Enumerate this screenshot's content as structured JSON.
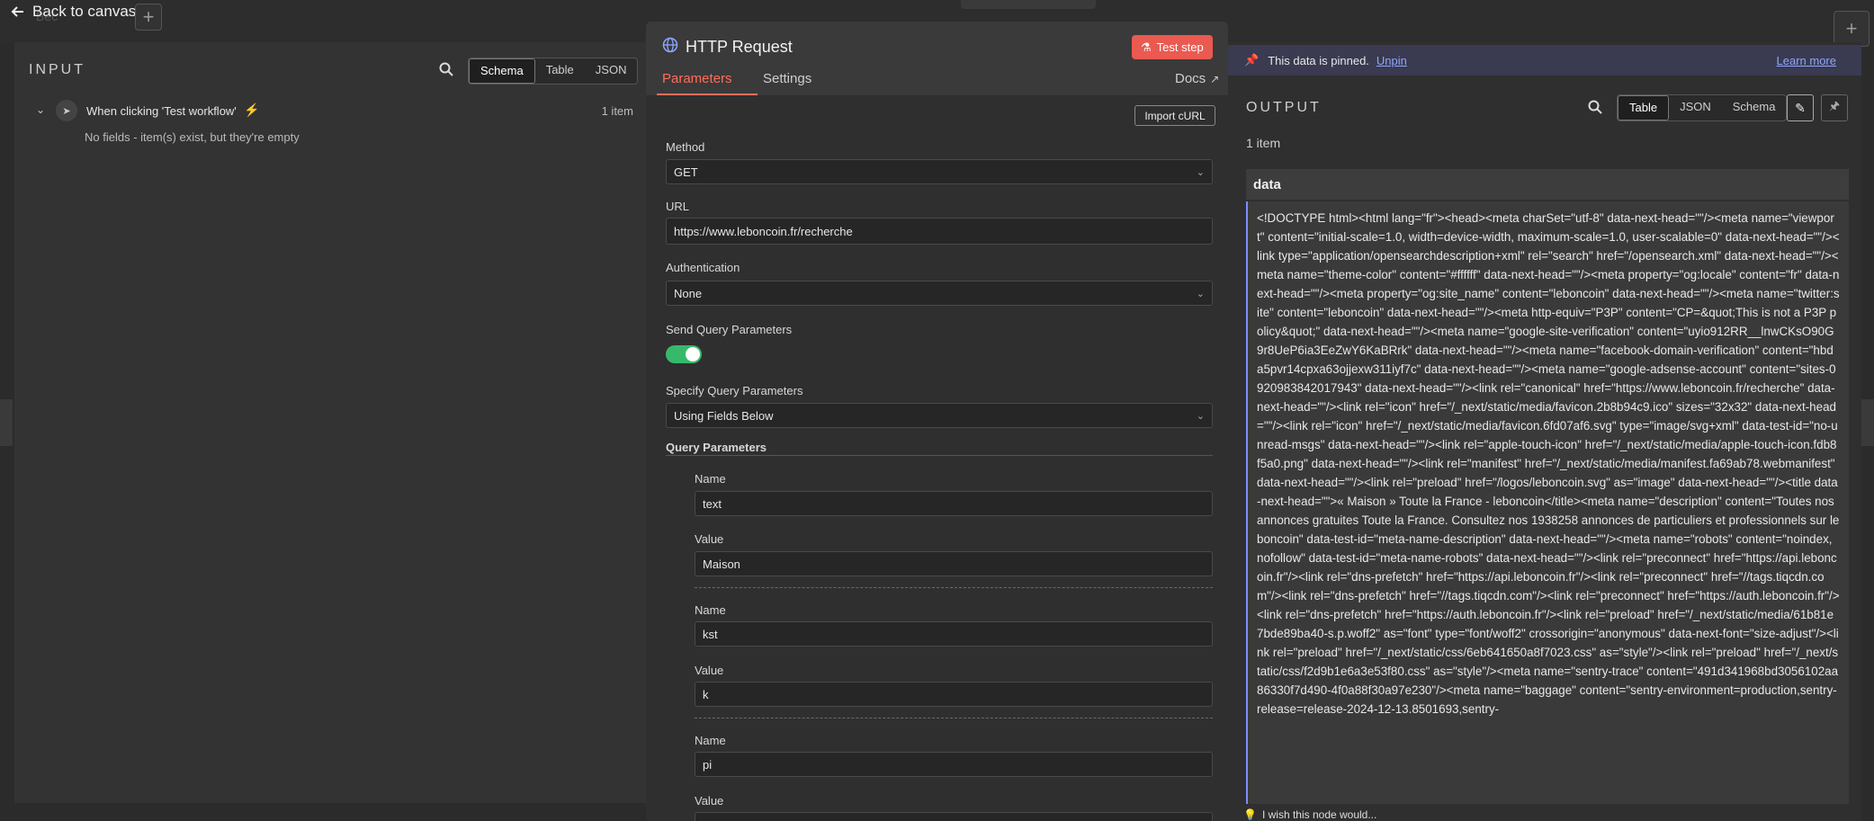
{
  "top": {
    "back_label": "Back to canvas",
    "bg_node_label": "Bec"
  },
  "input": {
    "title": "INPUT",
    "view_tabs": [
      "Schema",
      "Table",
      "JSON"
    ],
    "trigger_label": "When clicking 'Test workflow'",
    "item_count": "1 item",
    "empty_message": "No fields - item(s) exist, but they're empty"
  },
  "node": {
    "title": "HTTP Request",
    "test_button": "Test step",
    "tabs": [
      "Parameters",
      "Settings"
    ],
    "docs_label": "Docs",
    "import_curl": "Import cURL",
    "method": {
      "label": "Method",
      "value": "GET"
    },
    "url": {
      "label": "URL",
      "value": "https://www.leboncoin.fr/recherche"
    },
    "authentication": {
      "label": "Authentication",
      "value": "None"
    },
    "send_query": {
      "label": "Send Query Parameters",
      "enabled": true
    },
    "specify_query": {
      "label": "Specify Query Parameters",
      "value": "Using Fields Below"
    },
    "query_section_label": "Query Parameters",
    "name_label": "Name",
    "value_label": "Value",
    "params": [
      {
        "name": "text",
        "value": "Maison"
      },
      {
        "name": "kst",
        "value": "k"
      },
      {
        "name": "pi",
        "value": ""
      }
    ]
  },
  "output": {
    "pinned_text": "This data is pinned.",
    "unpin": "Unpin",
    "learn_more": "Learn more",
    "title": "OUTPUT",
    "view_tabs": [
      "Table",
      "JSON",
      "Schema"
    ],
    "item_count": "1 item",
    "column_header": "data",
    "data_text": "<!DOCTYPE html><html lang=\"fr\"><head><meta charSet=\"utf-8\" data-next-head=\"\"/><meta name=\"viewport\" content=\"initial-scale=1.0, width=device-width, maximum-scale=1.0, user-scalable=0\" data-next-head=\"\"/><link type=\"application/opensearchdescription+xml\" rel=\"search\" href=\"/opensearch.xml\" data-next-head=\"\"/><meta name=\"theme-color\" content=\"#ffffff\" data-next-head=\"\"/><meta property=\"og:locale\" content=\"fr\" data-next-head=\"\"/><meta property=\"og:site_name\" content=\"leboncoin\" data-next-head=\"\"/><meta name=\"twitter:site\" content=\"leboncoin\" data-next-head=\"\"/><meta http-equiv=\"P3P\" content=\"CP=&quot;This is not a P3P policy&quot;\" data-next-head=\"\"/><meta name=\"google-site-verification\" content=\"uyio912RR__lnwCKsO90G9r8UeP6ia3EeZwY6KaBRrk\" data-next-head=\"\"/><meta name=\"facebook-domain-verification\" content=\"hbda5pvr14cpxa63ojjexw311iyf7c\" data-next-head=\"\"/><meta name=\"google-adsense-account\" content=\"sites-0920983842017943\" data-next-head=\"\"/><link rel=\"canonical\" href=\"https://www.leboncoin.fr/recherche\" data-next-head=\"\"/><link rel=\"icon\" href=\"/_next/static/media/favicon.2b8b94c9.ico\" sizes=\"32x32\" data-next-head=\"\"/><link rel=\"icon\" href=\"/_next/static/media/favicon.6fd07af6.svg\" type=\"image/svg+xml\" data-test-id=\"no-unread-msgs\" data-next-head=\"\"/><link rel=\"apple-touch-icon\" href=\"/_next/static/media/apple-touch-icon.fdb8f5a0.png\" data-next-head=\"\"/><link rel=\"manifest\" href=\"/_next/static/media/manifest.fa69ab78.webmanifest\" data-next-head=\"\"/><link rel=\"preload\" href=\"/logos/leboncoin.svg\" as=\"image\" data-next-head=\"\"/><title data-next-head=\"\">« Maison » Toute la France - leboncoin</title><meta name=\"description\" content=\"Toutes nos annonces gratuites Toute la France. Consultez nos 1938258 annonces de particuliers et professionnels sur leboncoin\" data-test-id=\"meta-name-description\" data-next-head=\"\"/><meta name=\"robots\" content=\"noindex, nofollow\" data-test-id=\"meta-name-robots\" data-next-head=\"\"/><link rel=\"preconnect\" href=\"https://api.leboncoin.fr\"/><link rel=\"dns-prefetch\" href=\"https://api.leboncoin.fr\"/><link rel=\"preconnect\" href=\"//tags.tiqcdn.com\"/><link rel=\"dns-prefetch\" href=\"//tags.tiqcdn.com\"/><link rel=\"preconnect\" href=\"https://auth.leboncoin.fr\"/><link rel=\"dns-prefetch\" href=\"https://auth.leboncoin.fr\"/><link rel=\"preload\" href=\"/_next/static/media/61b81e7bde89ba40-s.p.woff2\" as=\"font\" type=\"font/woff2\" crossorigin=\"anonymous\" data-next-font=\"size-adjust\"/><link rel=\"preload\" href=\"/_next/static/css/6eb641650a8f7023.css\" as=\"style\"/><link rel=\"preload\" href=\"/_next/static/css/f2d9b1e6a3e53f80.css\" as=\"style\"/><meta name=\"sentry-trace\" content=\"491d341968bd3056102aa86330f7d490-4f0a88f30a97e230\"/><meta name=\"baggage\" content=\"sentry-environment=production,sentry-release=release-2024-12-13.8501693,sentry-",
    "hint": "I wish this node would..."
  },
  "colors": {
    "accent": "#ff6d5a",
    "toggle_on": "#37b96b",
    "link": "#8ea6ff"
  }
}
